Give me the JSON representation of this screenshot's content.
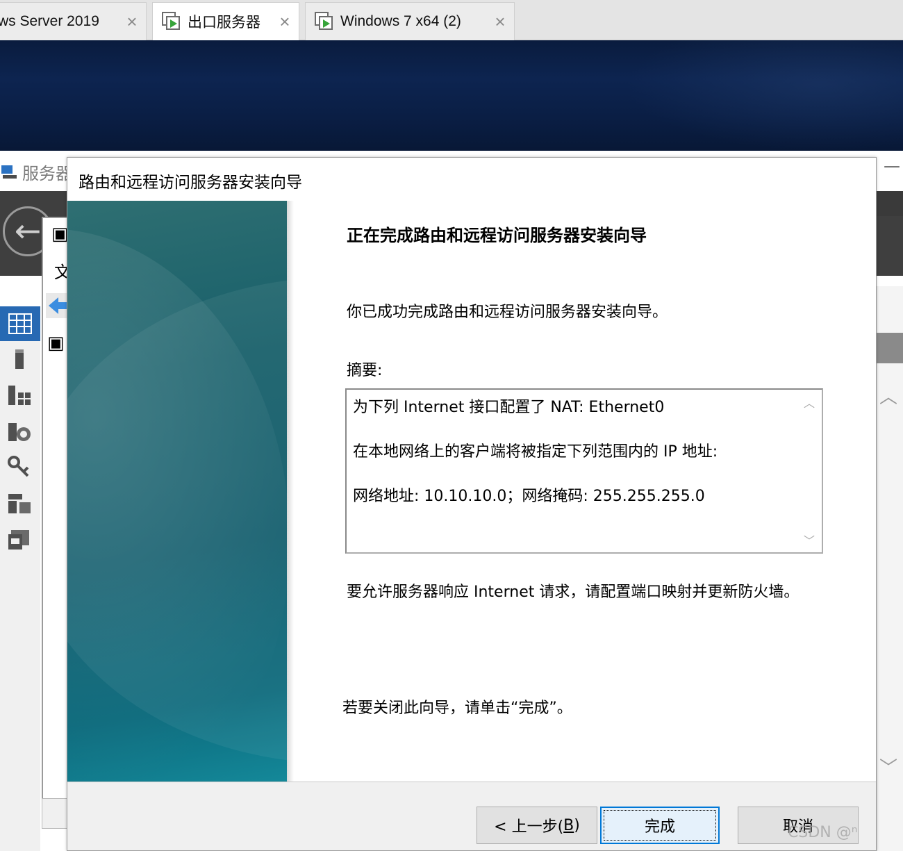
{
  "tabs": [
    {
      "label": "ws Server 2019",
      "close": "×"
    },
    {
      "label": "出口服务器",
      "close": "×"
    },
    {
      "label": "Windows 7 x64 (2)",
      "close": "×"
    }
  ],
  "server_manager": {
    "title": "服务器",
    "minimize": "—",
    "menu_fragment": "文",
    "back_icon": "←",
    "scroll_up": "︿",
    "scroll_down": "﹀"
  },
  "wizard": {
    "title": "路由和远程访问服务器安装向导",
    "heading": "正在完成路由和远程访问服务器安装向导",
    "success_text": "你已成功完成路由和远程访问服务器安装向导。",
    "summary_label": "摘要:",
    "summary_lines": [
      "为下列 Internet 接口配置了 NAT: Ethernet0",
      "在本地网络上的客户端将被指定下列范围内的 IP 地址:",
      "网络地址: 10.10.10.0；网络掩码: 255.255.255.0"
    ],
    "note": "要允许服务器响应 Internet 请求，请配置端口映射并更新防火墙。",
    "close_hint": "若要关闭此向导，请单击“完成”。",
    "buttons": {
      "back_prefix": "< 上一步(",
      "back_key": "B",
      "back_suffix": ")",
      "finish": "完成",
      "cancel": "取消"
    },
    "summary_scroll_up": "︿",
    "summary_scroll_down": "﹀"
  },
  "watermark": "CSDN @ⁿ",
  "colors": {
    "accent": "#0078d7",
    "banner_teal": "#0d5a6a",
    "desktop_navy": "#0d2450",
    "nav_selected": "#2769b3"
  }
}
